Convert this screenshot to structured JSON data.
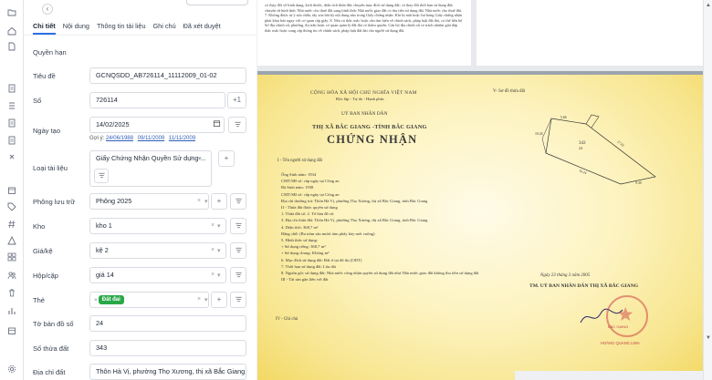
{
  "tabs": [
    {
      "label": "Chi tiết",
      "active": true
    },
    {
      "label": "Nội dung",
      "active": false
    },
    {
      "label": "Thông tin tài liệu",
      "active": false
    },
    {
      "label": "Ghi chú",
      "active": false
    },
    {
      "label": "Đã xét duyệt",
      "active": false
    }
  ],
  "section_title": "Quyền hạn",
  "fields": {
    "title": {
      "label": "Tiêu đề",
      "value": "GCNQSDD_AB726114_11112009_01-02"
    },
    "number": {
      "label": "Số",
      "value": "726114",
      "suffix": "+1"
    },
    "created_date": {
      "label": "Ngày tạo",
      "value": "14/02/2025",
      "hint_prefix": "Gợi ý:",
      "hints": [
        "24/06/1988",
        "09/11/2009",
        "11/11/2009"
      ]
    },
    "doc_type": {
      "label": "Loại tài liệu",
      "value": "Giấy Chứng Nhận Quyền Sử dụng ..."
    },
    "archive_room": {
      "label": "Phông lưu trữ",
      "value": "Phông 2025"
    },
    "warehouse": {
      "label": "Kho",
      "value": "kho 1"
    },
    "shelf": {
      "label": "Giá/kệ",
      "value": "kệ 2"
    },
    "box": {
      "label": "Hộp/cặp",
      "value": "giá 14"
    },
    "tags": {
      "label": "Thẻ",
      "value": "Đất đai",
      "tag_color": "#29a847"
    },
    "map_sheet": {
      "label": "Tờ bản đồ số",
      "value": "24"
    },
    "parcel": {
      "label": "Số thửa đất",
      "value": "343"
    },
    "address": {
      "label": "Địa chỉ đất",
      "value": "Thôn Hà Vị, phường Thọ Xương, thị xã Bắc Giang, t"
    }
  },
  "controls": {
    "plus": "+",
    "clear": "×",
    "caret": "▾"
  },
  "rail_icons": [
    "folder-icon",
    "home-icon",
    "file-icon",
    "document-icon",
    "list-icon",
    "document-icon",
    "document-icon",
    "close-icon",
    "calendar-icon",
    "tag-icon",
    "hash-icon",
    "alert-icon",
    "grid-icon",
    "users-icon",
    "trash-icon",
    "bar-chart-icon",
    "box-icon",
    "settings-icon"
  ],
  "accent_color": "#2f6fe4",
  "document": {
    "page1_text": "có thay đổi về hình dạng, kích thước, diện tích thửa đất; chuyển mục đích sử dụng đất; có thay đổi thời hạn sử dụng đất; chuyển từ hình thức Nhà nước cho thuê đất sang hình thức Nhà nước giao đất có thu tiền sử dụng đất. Nhà nước cho thuê đất.\n7. Không được tự ý sửa chữa, tẩy xóa bất kỳ nội dung nào trong Giấy chứng nhận. Khi bị mất hoặc hư hỏng Giấy chứng nhận phải khai báo ngay với cơ quan cấp giấy.\n8. Nếu có thắc mắc hoặc cần tìm hiểu về chính sách, pháp luật đất đai, có thể liên hệ Sở địa chính xã, phường, thị trấn hoặc cơ quan quản lý đất đai có thẩm quyền. Cán bộ địa chính xã có trách nhiệm giải đáp thắc mắc hoặc cung cấp thông tin về chính sách, pháp luật đất đai cho người sử dụng đất.",
    "nation": "CỘNG HÒA XÃ HỘI CHỦ NGHĨA VIỆT NAM",
    "motto": "Độc lập - Tự do - Hạnh phúc",
    "lot_diagram": "V- Sơ đồ thửa đất",
    "committee": "UỶ BAN NHÂN DÂN",
    "town": "THỊ XÃ BẮC GIANG -TỈNH BẮC GIANG",
    "cert_title": "CHỨNG NHẬN",
    "section_1": "I - Tên người sử dụng đất",
    "body_lines": [
      "Ông                                Sinh năm: 1934",
      "CMT/SĐ số:                   cấp ngày             tại Công an",
      "Bà                                 Sinh năm: 1938",
      "CMT/SĐ số:                   cấp ngày             tại Công an",
      "Địa chỉ thường trú: Thôn Hà Vị, phường Thọ Xương, thị xã Bắc Giang, tỉnh Bắc Giang",
      "II - Thửa đất được quyền sử dụng",
      "1. Thửa đất số:              2. Tờ bản đồ số:",
      "3. Địa chỉ thửa đất:    Thôn Hà Vị, phường Thọ Xương, thị xã Bắc Giang, tỉnh Bắc Giang",
      "4. Diện tích:    368,7         m²",
      "   Bằng chữ:    (Ba trăm sáu mươi tám phẩy bảy mét vuông)",
      "5. Hình thức sử dụng:",
      "   + Sử dụng riêng:        368,7         m²",
      "   + Sử dụng chung:        Không        m²",
      "6. Mục đích sử dụng đất:    Đất ở tại đô thị (ODT)",
      "7. Thời hạn sử dụng đất:    Lâu dài",
      "8. Nguồn gốc sử dụng đất: Nhà nước công nhận quyền sử dụng đất như Nhà nước giao đất không thu tiền sử dụng đất",
      "III - Tài sản gắn liền với đất"
    ],
    "sign_date": "Ngày 23 tháng 3 năm 2005",
    "signer": "TM. UỶ BAN NHÂN DÂN THỊ XÃ BẮC GIANG",
    "notes_section": "IV - Ghi chú",
    "stamp_text": "BẮC GIANG",
    "stamp_caption": "HOÀNG QUANG LINH",
    "lot_numbers": [
      "343",
      "24",
      "27.81",
      "9.30",
      "16.24",
      "10.24",
      "5.66"
    ]
  }
}
